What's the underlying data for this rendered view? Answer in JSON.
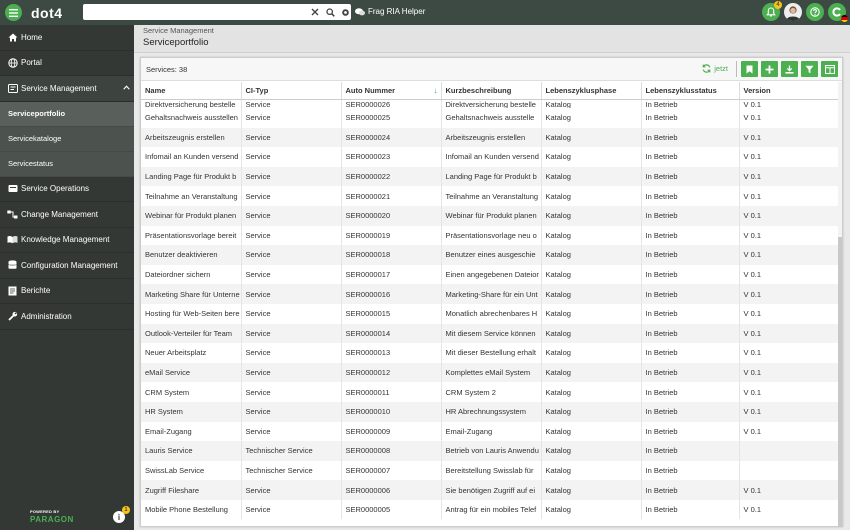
{
  "app": {
    "name": "dot4"
  },
  "search": {
    "placeholder": "",
    "value": ""
  },
  "ria_label": "Frag RIA Helper",
  "notifications_badge": "4",
  "sidebar": {
    "items": [
      {
        "label": "Home",
        "icon": "home-icon"
      },
      {
        "label": "Portal",
        "icon": "globe-icon"
      },
      {
        "label": "Service Management",
        "icon": "service-management-icon"
      }
    ],
    "subitems": [
      {
        "label": "Serviceportfolio"
      },
      {
        "label": "Servicekataloge"
      },
      {
        "label": "Servicestatus"
      }
    ],
    "items2": [
      {
        "label": "Service Operations",
        "icon": "service-operations-icon"
      },
      {
        "label": "Change Management",
        "icon": "change-management-icon"
      },
      {
        "label": "Knowledge Management",
        "icon": "book-icon"
      },
      {
        "label": "Configuration Management",
        "icon": "database-icon"
      },
      {
        "label": "Berichte",
        "icon": "report-icon"
      },
      {
        "label": "Administration",
        "icon": "wrench-icon"
      }
    ],
    "powered_by": "POWERED BY",
    "powered_logo": "PARAGON",
    "info_badge": "1"
  },
  "breadcrumb": "Service Management",
  "page_title": "Serviceportfolio",
  "services_count": "Services: 38",
  "refresh_label": "jetzt",
  "columns": [
    "Name",
    "CI-Typ",
    "Auto Nummer",
    "Kurzbeschreibung",
    "Lebenszyklusphase",
    "Lebenszyklusstatus",
    "Version"
  ],
  "partial_row": [
    "Direktversicherung bestelle",
    "Service",
    "SER0000026",
    "Direktversicherung bestelle",
    "Katalog",
    "In Betrieb",
    "V 0.1"
  ],
  "rows": [
    [
      "Gehaltsnachweis ausstellen",
      "Service",
      "SER0000025",
      "Gehaltsnachweis ausstelle",
      "Katalog",
      "In Betrieb",
      "V 0.1"
    ],
    [
      "Arbeitszeugnis erstellen",
      "Service",
      "SER0000024",
      "Arbeitszeugnis erstellen",
      "Katalog",
      "In Betrieb",
      "V 0.1"
    ],
    [
      "Infomail an Kunden versend",
      "Service",
      "SER0000023",
      "Infomail an Kunden versend",
      "Katalog",
      "In Betrieb",
      "V 0.1"
    ],
    [
      "Landing Page für Produkt b",
      "Service",
      "SER0000022",
      "Landing Page für Produkt b",
      "Katalog",
      "In Betrieb",
      "V 0.1"
    ],
    [
      "Teilnahme an Veranstaltung",
      "Service",
      "SER0000021",
      "Teilnahme an Veranstaltung",
      "Katalog",
      "In Betrieb",
      "V 0.1"
    ],
    [
      "Webinar für Produkt planen",
      "Service",
      "SER0000020",
      "Webinar für Produkt planen",
      "Katalog",
      "In Betrieb",
      "V 0.1"
    ],
    [
      "Präsentationsvorlage bereit",
      "Service",
      "SER0000019",
      "Präsentationsvorlage neu o",
      "Katalog",
      "In Betrieb",
      "V 0.1"
    ],
    [
      "Benutzer deaktivieren",
      "Service",
      "SER0000018",
      "Benutzer eines ausgeschie",
      "Katalog",
      "In Betrieb",
      "V 0.1"
    ],
    [
      "Dateiordner sichern",
      "Service",
      "SER0000017",
      "Einen angegebenen Dateior",
      "Katalog",
      "In Betrieb",
      "V 0.1"
    ],
    [
      "Marketing Share für Unterne",
      "Service",
      "SER0000016",
      "Marketing-Share für ein Unt",
      "Katalog",
      "In Betrieb",
      "V 0.1"
    ],
    [
      "Hosting für Web-Seiten bere",
      "Service",
      "SER0000015",
      "Monatlich abrechenbares H",
      "Katalog",
      "In Betrieb",
      "V 0.1"
    ],
    [
      "Outlook-Verteiler für Team",
      "Service",
      "SER0000014",
      "Mit diesem Service können",
      "Katalog",
      "In Betrieb",
      "V 0.1"
    ],
    [
      "Neuer Arbeitsplatz",
      "Service",
      "SER0000013",
      "Mit dieser Bestellung erhalt",
      "Katalog",
      "In Betrieb",
      "V 0.1"
    ],
    [
      "eMail Service",
      "Service",
      "SER0000012",
      "Komplettes eMail System",
      "Katalog",
      "In Betrieb",
      "V 0.1"
    ],
    [
      "CRM System",
      "Service",
      "SER0000011",
      "CRM System 2",
      "Katalog",
      "In Betrieb",
      "V 0.1"
    ],
    [
      "HR System",
      "Service",
      "SER0000010",
      "HR Abrechnungssystem",
      "Katalog",
      "In Betrieb",
      "V 0.1"
    ],
    [
      "Email-Zugang",
      "Service",
      "SER0000009",
      "Email-Zugang",
      "Katalog",
      "In Betrieb",
      "V 0.1"
    ],
    [
      "Lauris Service",
      "Technischer Service",
      "SER0000008",
      "Betrieb von Lauris Anwendu",
      "Katalog",
      "In Betrieb",
      ""
    ],
    [
      "SwissLab Service",
      "Technischer Service",
      "SER0000007",
      "Bereitstellung Swisslab für",
      "Katalog",
      "In Betrieb",
      ""
    ],
    [
      "Zugriff Fileshare",
      "Service",
      "SER0000006",
      "Sie benötigen Zugriff auf ei",
      "Katalog",
      "In Betrieb",
      "V 0.1"
    ],
    [
      "Mobile Phone Bestellung",
      "Service",
      "SER0000005",
      "Antrag für ein mobiles Telef",
      "Katalog",
      "In Betrieb",
      "V 0.1"
    ]
  ],
  "colors": {
    "accent": "#4caf50",
    "topbar": "#3d4a44",
    "sidebar": "#333835"
  }
}
